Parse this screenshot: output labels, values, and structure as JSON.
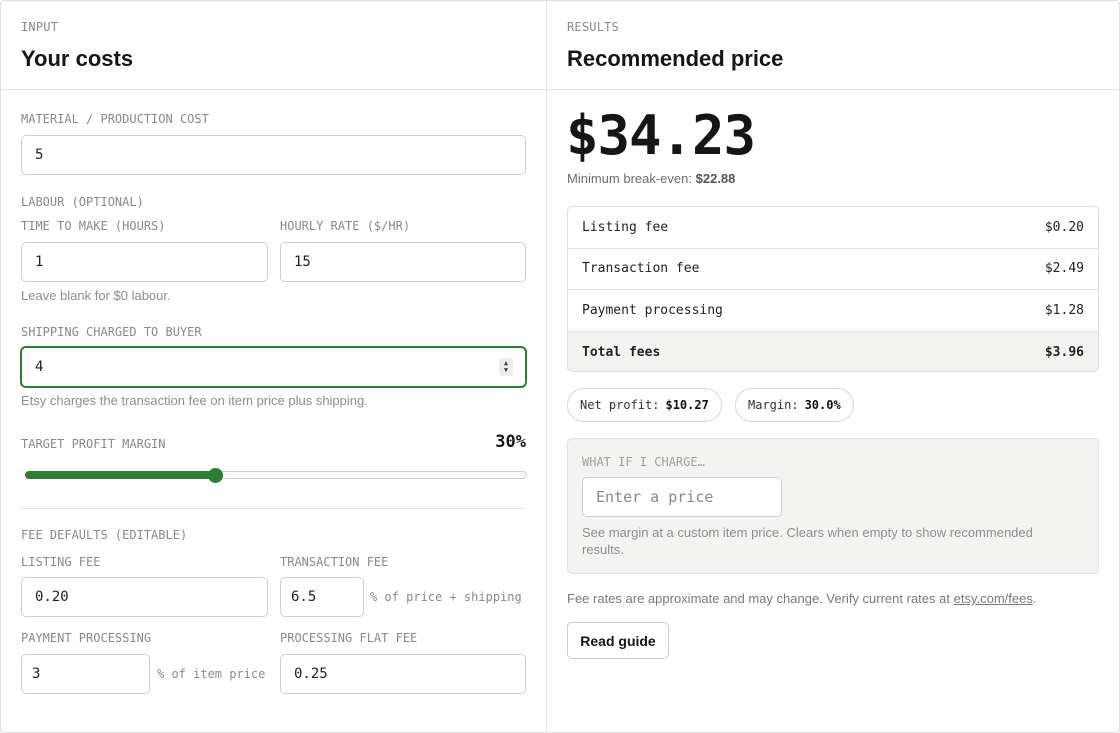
{
  "input_panel": {
    "eyebrow": "INPUT",
    "title": "Your costs",
    "material_label": "MATERIAL / PRODUCTION COST",
    "material_value": "5",
    "labour_heading": "LABOUR (OPTIONAL)",
    "time_label": "TIME TO MAKE (HOURS)",
    "time_value": "1",
    "rate_label": "HOURLY RATE ($/HR)",
    "rate_value": "15",
    "labour_help": "Leave blank for $0 labour.",
    "shipping_label": "SHIPPING CHARGED TO BUYER",
    "shipping_value": "4",
    "shipping_help": "Etsy charges the transaction fee on item price plus shipping.",
    "margin_label": "TARGET PROFIT MARGIN",
    "margin_display": "30%",
    "margin_slider_percent": 38
  },
  "fee_defaults": {
    "heading": "FEE DEFAULTS (EDITABLE)",
    "listing_label": "LISTING FEE",
    "listing_value": "0.20",
    "transaction_label": "TRANSACTION FEE",
    "transaction_value": "6.5",
    "transaction_suffix": "% of price + shipping",
    "processing_label": "PAYMENT PROCESSING",
    "processing_value": "3",
    "processing_suffix": "% of item price",
    "flat_label": "PROCESSING FLAT FEE",
    "flat_value": "0.25"
  },
  "results_panel": {
    "eyebrow": "RESULTS",
    "title": "Recommended price",
    "price": "$34.23",
    "breakeven_label": "Minimum break-even:",
    "breakeven_value": "$22.88",
    "fees": [
      {
        "label": "Listing fee",
        "value": "$0.20"
      },
      {
        "label": "Transaction fee",
        "value": "$2.49"
      },
      {
        "label": "Payment processing",
        "value": "$1.28"
      },
      {
        "label": "Total fees",
        "value": "$3.96"
      }
    ],
    "net_profit_label": "Net profit:",
    "net_profit_value": "$10.27",
    "margin_label": "Margin:",
    "margin_value": "30.0%",
    "whatif_heading": "WHAT IF I CHARGE…",
    "whatif_placeholder": "Enter a price",
    "whatif_help_line1": "See margin at a custom item price. Clears when empty to show recommended",
    "whatif_help_line2": "results.",
    "disclaimer_text": "Fee rates are approximate and may change. Verify current rates at",
    "disclaimer_link": "etsy.com/fees",
    "disclaimer_end": ".",
    "guide_button": "Read guide"
  },
  "colors": {
    "accent": "#2e7d32",
    "border": "#cfcfcf",
    "muted_text": "#8a8a8a",
    "panel_bg": "#f3f3f1"
  },
  "icons": {
    "stepper": "number-stepper-icon"
  }
}
